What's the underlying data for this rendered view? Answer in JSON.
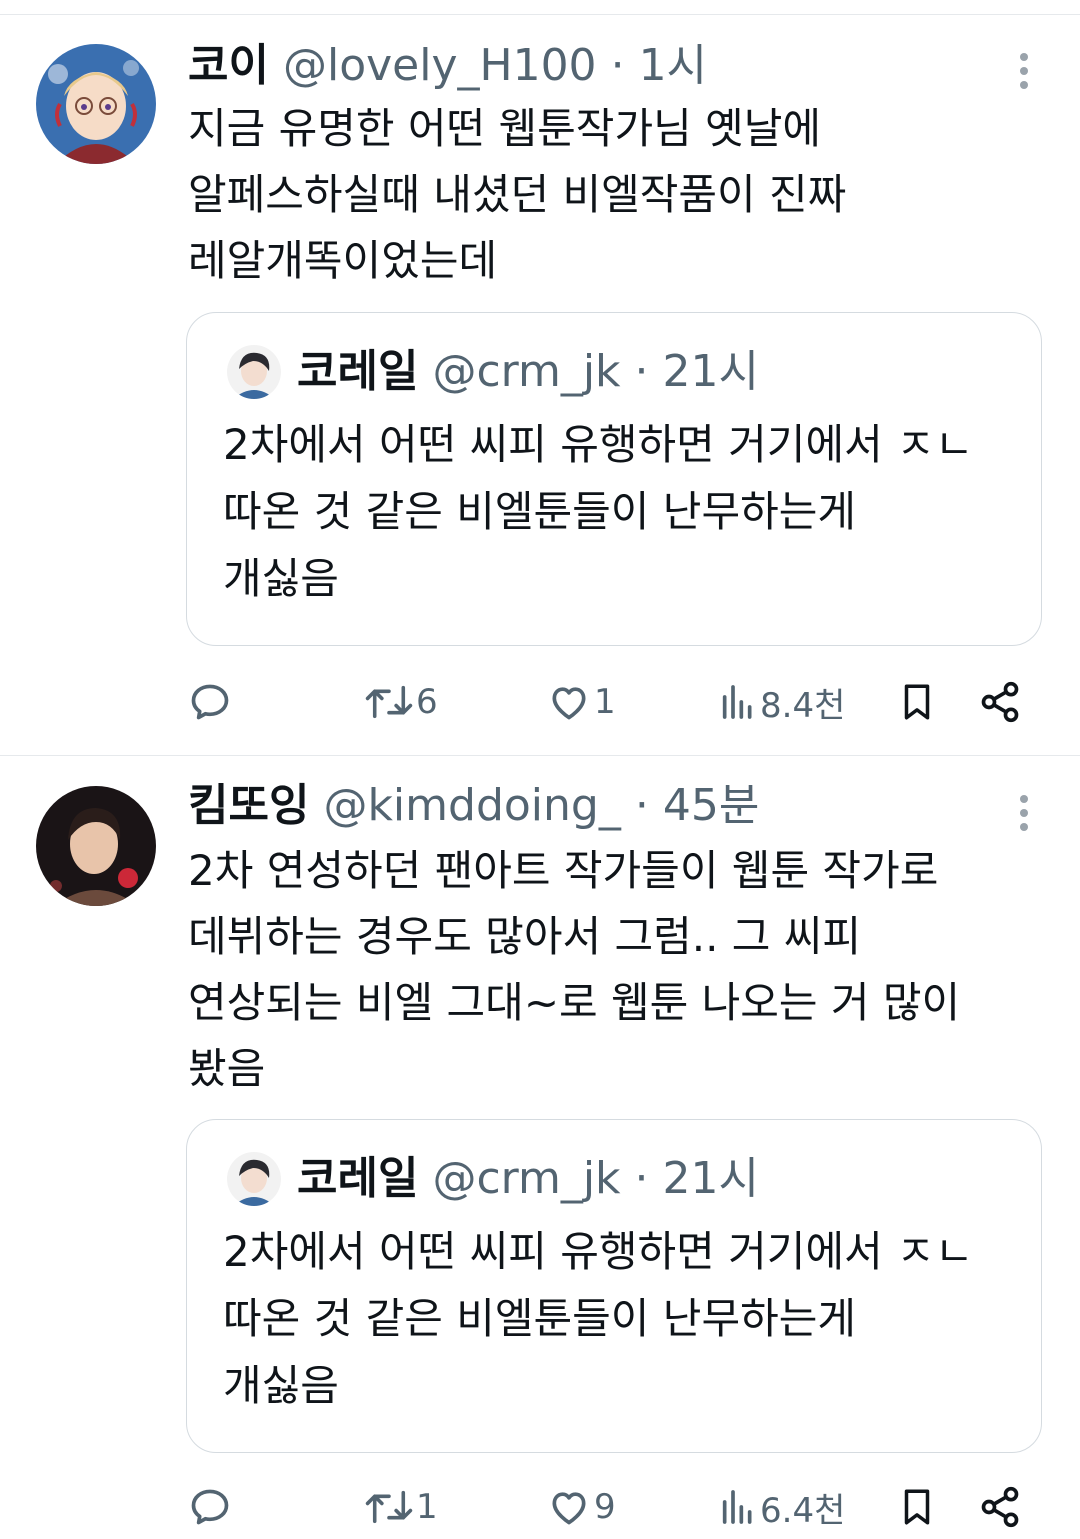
{
  "tweets": [
    {
      "name": "코이",
      "handle": "@lovely_H100",
      "dot": "·",
      "time": "1시",
      "lines": [
        "지금 유명한 어떤 웹툰작가님 옛날에",
        "알페스하실때 내셨던 비엘작품이 진짜",
        "레알개똑이었는데"
      ],
      "quote": {
        "name": "코레일",
        "handle": "@crm_jk",
        "dot": "·",
        "time": "21시",
        "lines": [
          "2차에서 어떤 씨피 유행하면 거기에서 ㅈㄴ",
          "따온 것 같은 비엘툰들이 난무하는게",
          "개싫음"
        ]
      },
      "actions": {
        "reply": "",
        "retweet": "6",
        "like": "1",
        "views": "8.4천"
      }
    },
    {
      "name": "킴또잉",
      "handle": "@kimddoing_",
      "dot": "·",
      "time": "45분",
      "lines": [
        "2차 연성하던 팬아트 작가들이 웹툰 작가로",
        "데뷔하는 경우도 많아서 그럼.. 그 씨피",
        "연상되는 비엘 그대~로 웹툰 나오는 거 많이",
        "봤음"
      ],
      "quote": {
        "name": "코레일",
        "handle": "@crm_jk",
        "dot": "·",
        "time": "21시",
        "lines": [
          "2차에서 어떤 씨피 유행하면 거기에서 ㅈㄴ",
          "따온 것 같은 비엘툰들이 난무하는게",
          "개싫음"
        ]
      },
      "actions": {
        "reply": "",
        "retweet": "1",
        "like": "9",
        "views": "6.4천"
      }
    }
  ],
  "colors": {
    "text": "#0f1419",
    "secondary": "#536471",
    "border": "#d5dbe0"
  },
  "icons": [
    "reply-icon",
    "retweet-icon",
    "like-icon",
    "views-icon",
    "bookmark-icon",
    "share-icon",
    "more-icon"
  ]
}
